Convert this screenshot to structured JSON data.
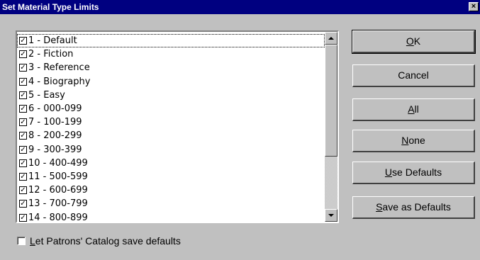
{
  "window": {
    "title": "Set Material Type Limits",
    "close_label": "×"
  },
  "list": {
    "check_glyph": "✓",
    "items": [
      {
        "label": "1 - Default",
        "checked": true
      },
      {
        "label": "2 - Fiction",
        "checked": true
      },
      {
        "label": "3 - Reference",
        "checked": true
      },
      {
        "label": "4 - Biography",
        "checked": true
      },
      {
        "label": "5 - Easy",
        "checked": true
      },
      {
        "label": "6 - 000-099",
        "checked": true
      },
      {
        "label": "7 - 100-199",
        "checked": true
      },
      {
        "label": "8 - 200-299",
        "checked": true
      },
      {
        "label": "9 - 300-399",
        "checked": true
      },
      {
        "label": "10 - 400-499",
        "checked": true
      },
      {
        "label": "11 - 500-599",
        "checked": true
      },
      {
        "label": "12 - 600-699",
        "checked": true
      },
      {
        "label": "13 - 700-799",
        "checked": true
      },
      {
        "label": "14 - 800-899",
        "checked": true
      }
    ]
  },
  "buttons": {
    "ok": {
      "mnemonic": "O",
      "rest": "K"
    },
    "cancel": {
      "label": "Cancel"
    },
    "all": {
      "mnemonic": "A",
      "rest": "ll"
    },
    "none": {
      "mnemonic": "N",
      "rest": "one"
    },
    "use_defaults": {
      "mnemonic": "U",
      "rest": "se Defaults"
    },
    "save_as_defaults": {
      "mnemonic": "S",
      "rest": "ave as Defaults"
    }
  },
  "footer": {
    "checkbox_checked": false,
    "label_mnemonic": "L",
    "label_rest": "et Patrons' Catalog save defaults"
  }
}
